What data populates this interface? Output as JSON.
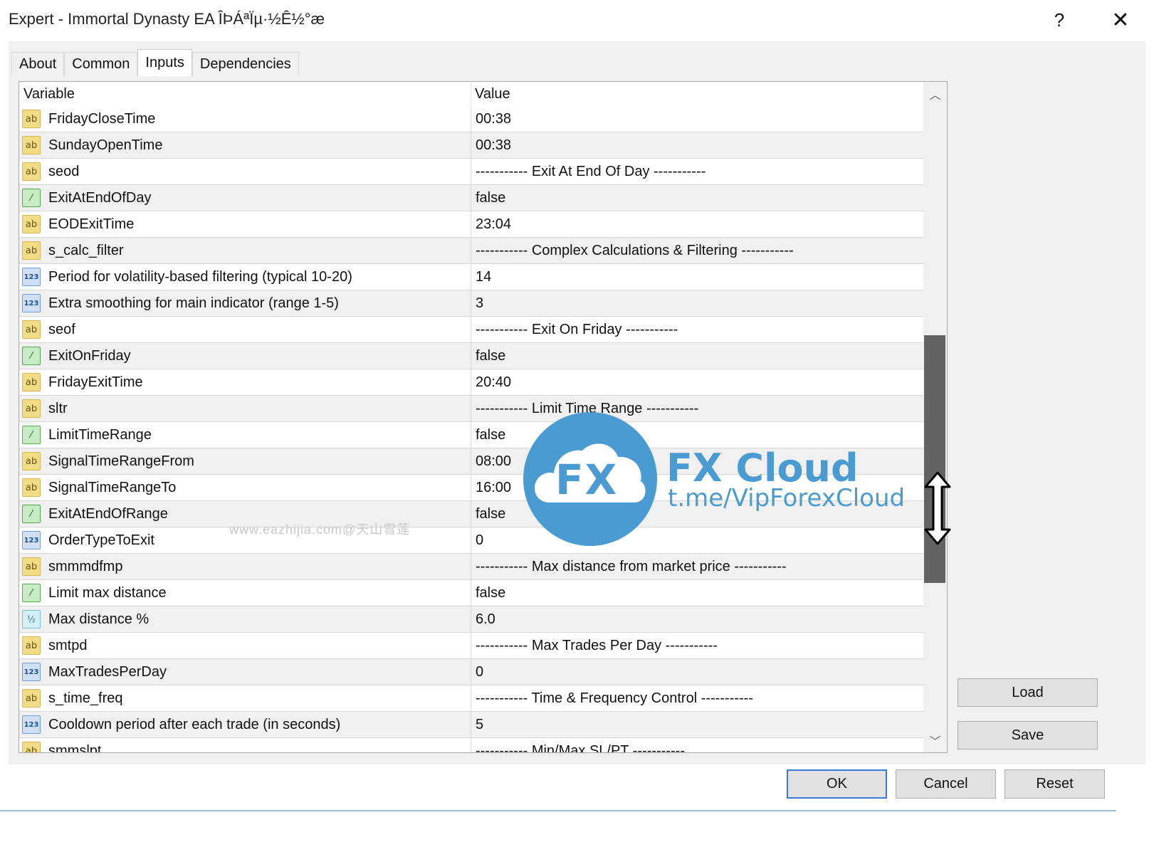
{
  "window": {
    "title": "Expert - Immortal Dynasty EA ÎÞÁªÏµ·½Ê½°æ",
    "help_label": "?",
    "close_label": "✕"
  },
  "tabs": [
    {
      "label": "About",
      "active": false
    },
    {
      "label": "Common",
      "active": false
    },
    {
      "label": "Inputs",
      "active": true
    },
    {
      "label": "Dependencies",
      "active": false
    }
  ],
  "grid": {
    "columns": {
      "variable": "Variable",
      "value": "Value"
    },
    "rows": [
      {
        "icon": "string-icon",
        "name": "FridayCloseTime",
        "value": "00:38"
      },
      {
        "icon": "string-icon",
        "name": "SundayOpenTime",
        "value": "00:38"
      },
      {
        "icon": "string-icon",
        "name": "seod",
        "value": "----------- Exit At End Of Day -----------"
      },
      {
        "icon": "boolean-icon",
        "name": "ExitAtEndOfDay",
        "value": "false"
      },
      {
        "icon": "string-icon",
        "name": "EODExitTime",
        "value": "23:04"
      },
      {
        "icon": "string-icon",
        "name": "s_calc_filter",
        "value": "----------- Complex Calculations & Filtering -----------"
      },
      {
        "icon": "integer-icon",
        "name": "Period for volatility-based filtering (typical 10-20)",
        "value": "14"
      },
      {
        "icon": "integer-icon",
        "name": "Extra smoothing for main indicator (range 1-5)",
        "value": "3"
      },
      {
        "icon": "string-icon",
        "name": "seof",
        "value": "----------- Exit On Friday -----------"
      },
      {
        "icon": "boolean-icon",
        "name": "ExitOnFriday",
        "value": "false"
      },
      {
        "icon": "string-icon",
        "name": "FridayExitTime",
        "value": "20:40"
      },
      {
        "icon": "string-icon",
        "name": "sltr",
        "value": "----------- Limit Time Range -----------"
      },
      {
        "icon": "boolean-icon",
        "name": "LimitTimeRange",
        "value": "false"
      },
      {
        "icon": "string-icon",
        "name": "SignalTimeRangeFrom",
        "value": "08:00"
      },
      {
        "icon": "string-icon",
        "name": "SignalTimeRangeTo",
        "value": "16:00"
      },
      {
        "icon": "boolean-icon",
        "name": "ExitAtEndOfRange",
        "value": "false"
      },
      {
        "icon": "integer-icon",
        "name": "OrderTypeToExit",
        "value": "0"
      },
      {
        "icon": "string-icon",
        "name": "smmmdfmp",
        "value": "----------- Max distance from market price -----------"
      },
      {
        "icon": "boolean-icon",
        "name": "Limit max distance",
        "value": "false"
      },
      {
        "icon": "double-icon",
        "name": "Max distance %",
        "value": "6.0"
      },
      {
        "icon": "string-icon",
        "name": "smtpd",
        "value": "----------- Max Trades Per Day -----------"
      },
      {
        "icon": "integer-icon",
        "name": "MaxTradesPerDay",
        "value": "0"
      },
      {
        "icon": "string-icon",
        "name": "s_time_freq",
        "value": "----------- Time & Frequency Control -----------"
      },
      {
        "icon": "integer-icon",
        "name": "Cooldown period after each trade (in seconds)",
        "value": "5"
      },
      {
        "icon": "string-icon",
        "name": "smmslpt",
        "value": "----------- Min/Max SL/PT -----------"
      }
    ],
    "icon_glyphs": {
      "string-icon": "ab",
      "integer-icon": "123",
      "boolean-icon": "⁄",
      "double-icon": "½"
    }
  },
  "watermark": {
    "badge_text": "FX",
    "brand": "FX Cloud",
    "link": "t.me/VipForexCloud",
    "site": "www.eazhijia.com@天山雪莲"
  },
  "buttons": {
    "load": "Load",
    "save": "Save",
    "ok": "OK",
    "cancel": "Cancel",
    "reset": "Reset"
  },
  "colors": {
    "watermark_blue": "#4a9bd1",
    "scroll_thumb": "#636363",
    "default_button_border": "#3b7ad8"
  }
}
